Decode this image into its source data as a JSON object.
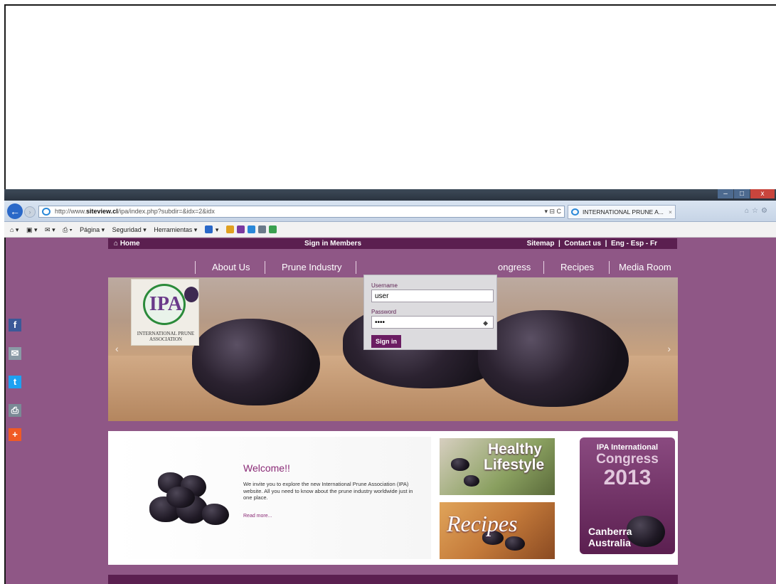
{
  "browser": {
    "url_prefix": "http://www.",
    "url_domain": "siteview.cl",
    "url_path": "/ipa/index.php?subdir=&idx=2&idx",
    "address_tools": "▾ ⊟ C",
    "tab_title": "INTERNATIONAL PRUNE A...",
    "tab_close": "×",
    "window_controls": [
      "–",
      "□",
      "x"
    ],
    "back_glyph": "←",
    "command_bar": [
      "Página ▾",
      "Seguridad ▾",
      "Herramientas ▾"
    ]
  },
  "site": {
    "topbar": {
      "home": "Home",
      "signin": "Sign in Members",
      "sitemap": "Sitemap",
      "contact": "Contact us",
      "lang": "Eng - Esp - Fr"
    },
    "nav": [
      "About Us",
      "Prune Industry",
      "ongress",
      "Recipes",
      "Media Room"
    ],
    "login": {
      "username_label": "Username",
      "username_value": "user",
      "password_label": "Password",
      "password_value": "••••",
      "submit_label": "Sign in"
    },
    "logo": {
      "text": "IPA",
      "caption": "INTERNATIONAL PRUNE ASSOCIATION"
    },
    "welcome": {
      "title": "Welcome!!",
      "body": "We invite you to explore the new International Prune Association (IPA) website. All you need to know about the prune industry worldwide just in one place.",
      "more": "Read more..."
    },
    "tiles": {
      "healthy_1": "Healthy",
      "healthy_2": "Lifestyle",
      "recipes": "Recipes",
      "congress_1": "IPA International",
      "congress_2": "Congress",
      "congress_3": "2013",
      "congress_4": "Canberra",
      "congress_5": "Australia"
    },
    "social_icons": [
      "facebook-icon",
      "email-icon",
      "twitter-icon",
      "print-icon",
      "share-plus-icon"
    ],
    "colors": {
      "page_bg": "#8f5786",
      "bar": "#5b1f50",
      "accent": "#8a2a76"
    }
  }
}
